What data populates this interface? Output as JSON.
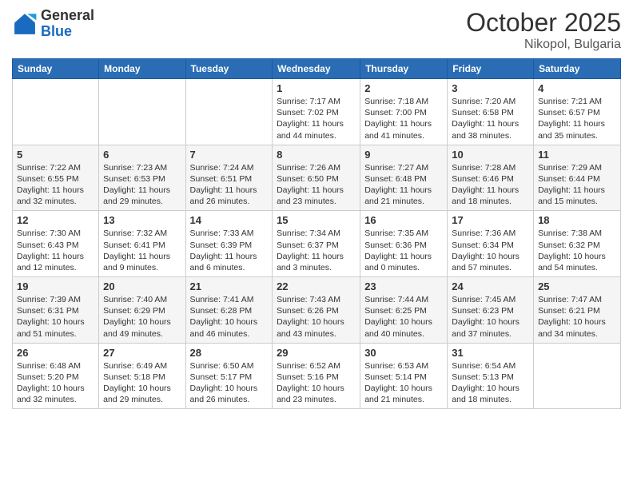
{
  "header": {
    "logo": {
      "general": "General",
      "blue": "Blue"
    },
    "title": "October 2025",
    "location": "Nikopol, Bulgaria"
  },
  "calendar": {
    "days_of_week": [
      "Sunday",
      "Monday",
      "Tuesday",
      "Wednesday",
      "Thursday",
      "Friday",
      "Saturday"
    ],
    "weeks": [
      [
        {
          "day": "",
          "info": ""
        },
        {
          "day": "",
          "info": ""
        },
        {
          "day": "",
          "info": ""
        },
        {
          "day": "1",
          "info": "Sunrise: 7:17 AM\nSunset: 7:02 PM\nDaylight: 11 hours and 44 minutes."
        },
        {
          "day": "2",
          "info": "Sunrise: 7:18 AM\nSunset: 7:00 PM\nDaylight: 11 hours and 41 minutes."
        },
        {
          "day": "3",
          "info": "Sunrise: 7:20 AM\nSunset: 6:58 PM\nDaylight: 11 hours and 38 minutes."
        },
        {
          "day": "4",
          "info": "Sunrise: 7:21 AM\nSunset: 6:57 PM\nDaylight: 11 hours and 35 minutes."
        }
      ],
      [
        {
          "day": "5",
          "info": "Sunrise: 7:22 AM\nSunset: 6:55 PM\nDaylight: 11 hours and 32 minutes."
        },
        {
          "day": "6",
          "info": "Sunrise: 7:23 AM\nSunset: 6:53 PM\nDaylight: 11 hours and 29 minutes."
        },
        {
          "day": "7",
          "info": "Sunrise: 7:24 AM\nSunset: 6:51 PM\nDaylight: 11 hours and 26 minutes."
        },
        {
          "day": "8",
          "info": "Sunrise: 7:26 AM\nSunset: 6:50 PM\nDaylight: 11 hours and 23 minutes."
        },
        {
          "day": "9",
          "info": "Sunrise: 7:27 AM\nSunset: 6:48 PM\nDaylight: 11 hours and 21 minutes."
        },
        {
          "day": "10",
          "info": "Sunrise: 7:28 AM\nSunset: 6:46 PM\nDaylight: 11 hours and 18 minutes."
        },
        {
          "day": "11",
          "info": "Sunrise: 7:29 AM\nSunset: 6:44 PM\nDaylight: 11 hours and 15 minutes."
        }
      ],
      [
        {
          "day": "12",
          "info": "Sunrise: 7:30 AM\nSunset: 6:43 PM\nDaylight: 11 hours and 12 minutes."
        },
        {
          "day": "13",
          "info": "Sunrise: 7:32 AM\nSunset: 6:41 PM\nDaylight: 11 hours and 9 minutes."
        },
        {
          "day": "14",
          "info": "Sunrise: 7:33 AM\nSunset: 6:39 PM\nDaylight: 11 hours and 6 minutes."
        },
        {
          "day": "15",
          "info": "Sunrise: 7:34 AM\nSunset: 6:37 PM\nDaylight: 11 hours and 3 minutes."
        },
        {
          "day": "16",
          "info": "Sunrise: 7:35 AM\nSunset: 6:36 PM\nDaylight: 11 hours and 0 minutes."
        },
        {
          "day": "17",
          "info": "Sunrise: 7:36 AM\nSunset: 6:34 PM\nDaylight: 10 hours and 57 minutes."
        },
        {
          "day": "18",
          "info": "Sunrise: 7:38 AM\nSunset: 6:32 PM\nDaylight: 10 hours and 54 minutes."
        }
      ],
      [
        {
          "day": "19",
          "info": "Sunrise: 7:39 AM\nSunset: 6:31 PM\nDaylight: 10 hours and 51 minutes."
        },
        {
          "day": "20",
          "info": "Sunrise: 7:40 AM\nSunset: 6:29 PM\nDaylight: 10 hours and 49 minutes."
        },
        {
          "day": "21",
          "info": "Sunrise: 7:41 AM\nSunset: 6:28 PM\nDaylight: 10 hours and 46 minutes."
        },
        {
          "day": "22",
          "info": "Sunrise: 7:43 AM\nSunset: 6:26 PM\nDaylight: 10 hours and 43 minutes."
        },
        {
          "day": "23",
          "info": "Sunrise: 7:44 AM\nSunset: 6:25 PM\nDaylight: 10 hours and 40 minutes."
        },
        {
          "day": "24",
          "info": "Sunrise: 7:45 AM\nSunset: 6:23 PM\nDaylight: 10 hours and 37 minutes."
        },
        {
          "day": "25",
          "info": "Sunrise: 7:47 AM\nSunset: 6:21 PM\nDaylight: 10 hours and 34 minutes."
        }
      ],
      [
        {
          "day": "26",
          "info": "Sunrise: 6:48 AM\nSunset: 5:20 PM\nDaylight: 10 hours and 32 minutes."
        },
        {
          "day": "27",
          "info": "Sunrise: 6:49 AM\nSunset: 5:18 PM\nDaylight: 10 hours and 29 minutes."
        },
        {
          "day": "28",
          "info": "Sunrise: 6:50 AM\nSunset: 5:17 PM\nDaylight: 10 hours and 26 minutes."
        },
        {
          "day": "29",
          "info": "Sunrise: 6:52 AM\nSunset: 5:16 PM\nDaylight: 10 hours and 23 minutes."
        },
        {
          "day": "30",
          "info": "Sunrise: 6:53 AM\nSunset: 5:14 PM\nDaylight: 10 hours and 21 minutes."
        },
        {
          "day": "31",
          "info": "Sunrise: 6:54 AM\nSunset: 5:13 PM\nDaylight: 10 hours and 18 minutes."
        },
        {
          "day": "",
          "info": ""
        }
      ]
    ]
  }
}
